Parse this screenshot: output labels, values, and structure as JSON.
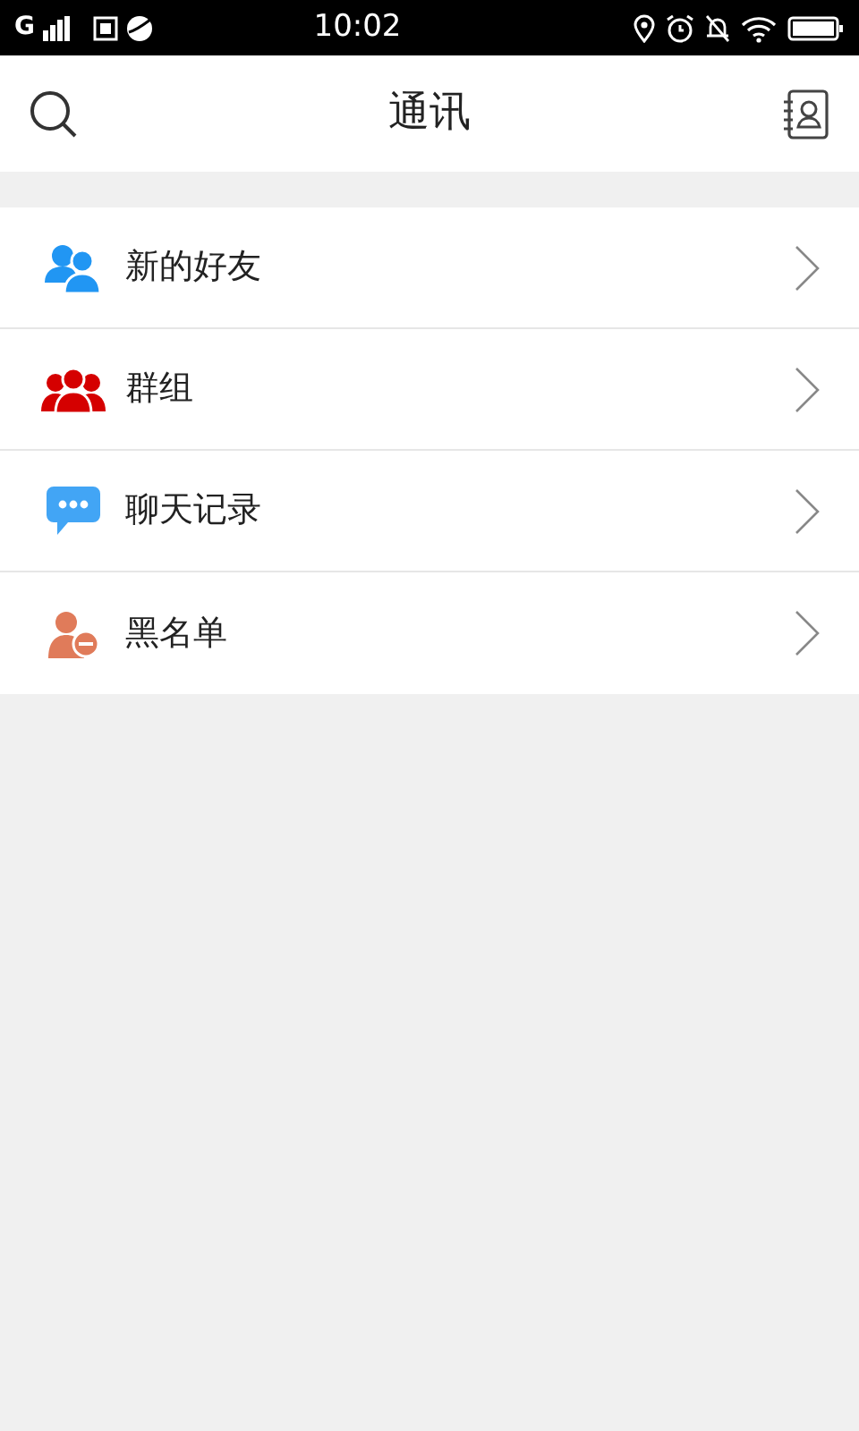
{
  "status_bar": {
    "network": "G",
    "time": "10:02"
  },
  "header": {
    "title": "通讯"
  },
  "menu": [
    {
      "kind": "friends",
      "label": "新的好友"
    },
    {
      "kind": "group",
      "label": "群组"
    },
    {
      "kind": "chat",
      "label": "聊天记录"
    },
    {
      "kind": "blocked",
      "label": "黑名单"
    }
  ]
}
